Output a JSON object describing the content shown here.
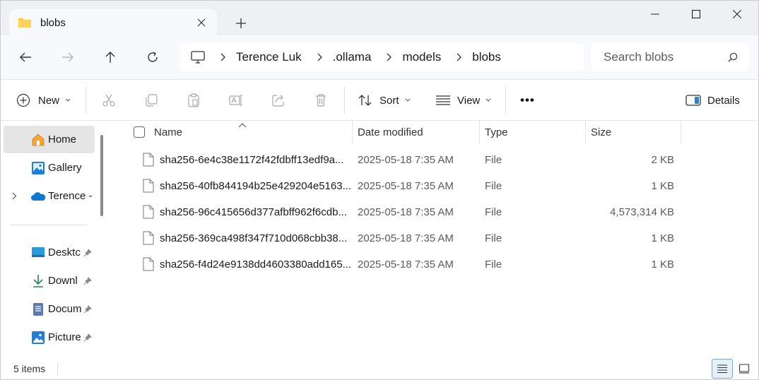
{
  "tab": {
    "title": "blobs"
  },
  "address": {
    "crumbs": [
      "Terence Luk",
      ".ollama",
      "models",
      "blobs"
    ]
  },
  "search": {
    "placeholder": "Search blobs"
  },
  "toolbar": {
    "new_label": "New",
    "sort_label": "Sort",
    "view_label": "View",
    "more_label": "•••",
    "details_label": "Details"
  },
  "nav": {
    "items": [
      {
        "label": "Home",
        "icon": "home-icon"
      },
      {
        "label": "Gallery",
        "icon": "gallery-icon"
      },
      {
        "label": "Terence -",
        "icon": "onedrive-icon"
      },
      {
        "label": "Desktc",
        "icon": "desktop-icon"
      },
      {
        "label": "Downl",
        "icon": "download-icon"
      },
      {
        "label": "Docum",
        "icon": "documents-icon"
      },
      {
        "label": "Picture",
        "icon": "pictures-icon"
      }
    ]
  },
  "columns": {
    "name": "Name",
    "date": "Date modified",
    "type": "Type",
    "size": "Size"
  },
  "files": [
    {
      "name": "sha256-6e4c38e1172f42fdbff13edf9a...",
      "date": "2025-05-18 7:35 AM",
      "type": "File",
      "size": "2 KB"
    },
    {
      "name": "sha256-40fb844194b25e429204e5163...",
      "date": "2025-05-18 7:35 AM",
      "type": "File",
      "size": "1 KB"
    },
    {
      "name": "sha256-96c415656d377afbff962f6cdb...",
      "date": "2025-05-18 7:35 AM",
      "type": "File",
      "size": "4,573,314 KB"
    },
    {
      "name": "sha256-369ca498f347f710d068cbb38...",
      "date": "2025-05-18 7:35 AM",
      "type": "File",
      "size": "1 KB"
    },
    {
      "name": "sha256-f4d24e9138dd4603380add165...",
      "date": "2025-05-18 7:35 AM",
      "type": "File",
      "size": "1 KB"
    }
  ],
  "status": {
    "count": "5 items"
  },
  "colors": {
    "accent": "#0067c0",
    "folder": "#f8c84a",
    "selected_nav": "#e5e5e5"
  }
}
